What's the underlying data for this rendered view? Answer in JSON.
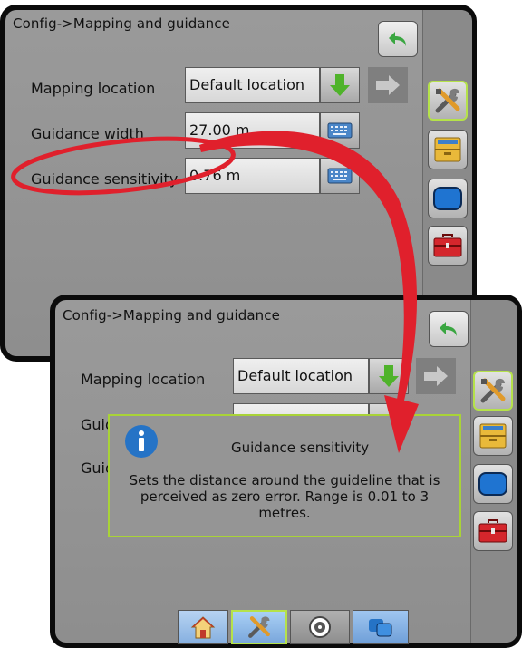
{
  "back_screen": {
    "title": "Config->Mapping and guidance",
    "rows": [
      {
        "label": "Mapping location",
        "value": "Default location"
      },
      {
        "label": "Guidance width",
        "value": "27.00 m"
      },
      {
        "label": "Guidance sensitivity",
        "value": "0.76 m"
      }
    ]
  },
  "front_screen": {
    "title": "Config->Mapping and guidance",
    "rows": [
      {
        "label": "Mapping location",
        "value": "Default location"
      },
      {
        "label": "Guid",
        "value": ""
      },
      {
        "label": "Guid",
        "value": ""
      }
    ],
    "popup": {
      "title": "Guidance sensitivity",
      "body": "Sets the distance around the guideline that is perceived as zero error. Range is 0.01 to 3 metres."
    }
  },
  "colors": {
    "accent": "#a9d337",
    "arrow": "#e0202c",
    "arrow_down": "#4fb32a"
  },
  "icons": {
    "back": "undo-arrow-icon",
    "tools": "tools-icon",
    "files": "file-drawer-icon",
    "screen": "screen-icon",
    "toolbox": "toolbox-icon",
    "home": "home-icon",
    "guidance": "guidance-icon",
    "chart": "chart-icon"
  }
}
